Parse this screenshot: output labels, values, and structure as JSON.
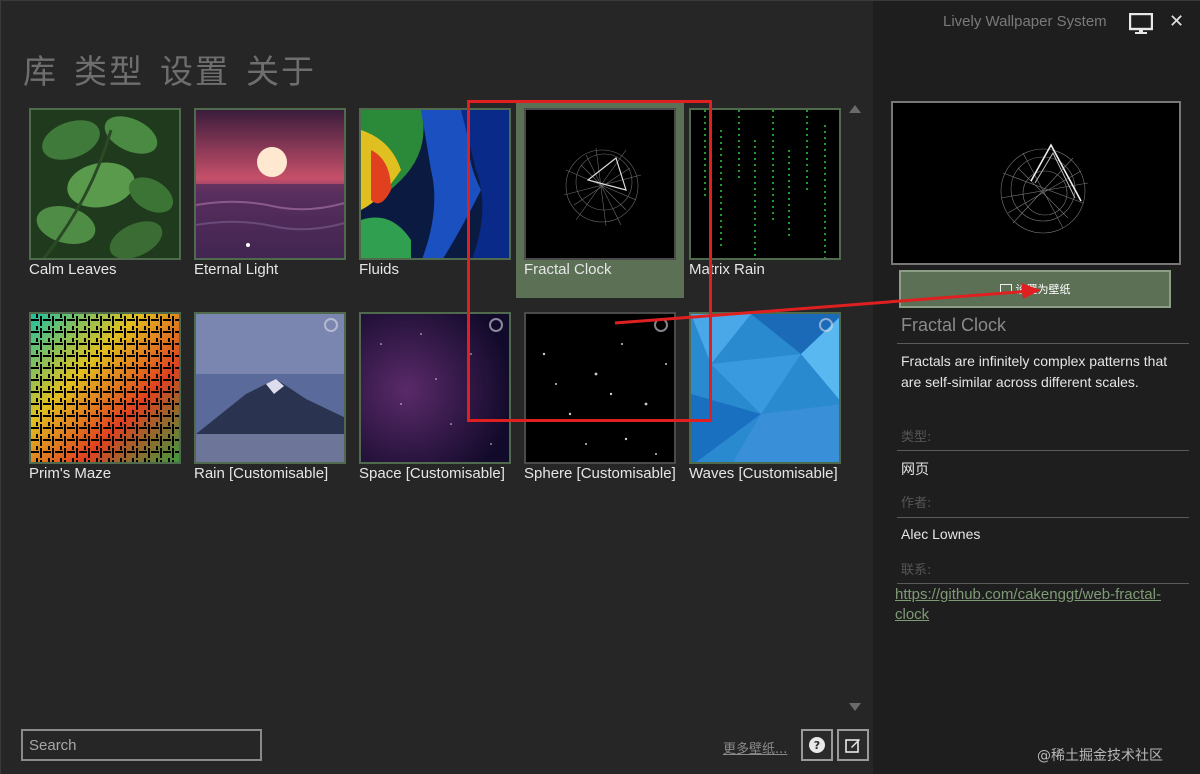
{
  "nav": {
    "items": [
      "库",
      "类型",
      "设置",
      "关于"
    ]
  },
  "library": {
    "tiles": [
      {
        "label": "Calm Leaves"
      },
      {
        "label": "Eternal Light"
      },
      {
        "label": "Fluids"
      },
      {
        "label": "Fractal Clock"
      },
      {
        "label": "Matrix Rain"
      },
      {
        "label": "Prim's Maze"
      },
      {
        "label": "Rain [Customisable]"
      },
      {
        "label": "Space [Customisable]"
      },
      {
        "label": "Sphere [Customisable]"
      },
      {
        "label": "Waves [Customisable]"
      }
    ]
  },
  "footer": {
    "search_placeholder": "Search",
    "more_wallpapers": "更多壁纸...",
    "help_icon": "help-icon",
    "edit_icon": "edit-icon"
  },
  "sidebar": {
    "app_title": "Lively Wallpaper System",
    "set_wallpaper_label": "设置为壁纸",
    "title": "Fractal Clock",
    "description": "Fractals are infinitely complex patterns that are self-similar across different scales.",
    "type_label": "类型:",
    "type_value": "网页",
    "author_label": "作者:",
    "author_value": "Alec Lownes",
    "contact_label": "联系:",
    "contact_value": "https://github.com/cakenggt/web-fractal-clock"
  },
  "watermark": "@稀土掘金技术社区",
  "colors": {
    "background": "#262626",
    "sidebar_background": "#1e1e1e",
    "accent": "#5b7055",
    "highlight": "#e02020"
  }
}
